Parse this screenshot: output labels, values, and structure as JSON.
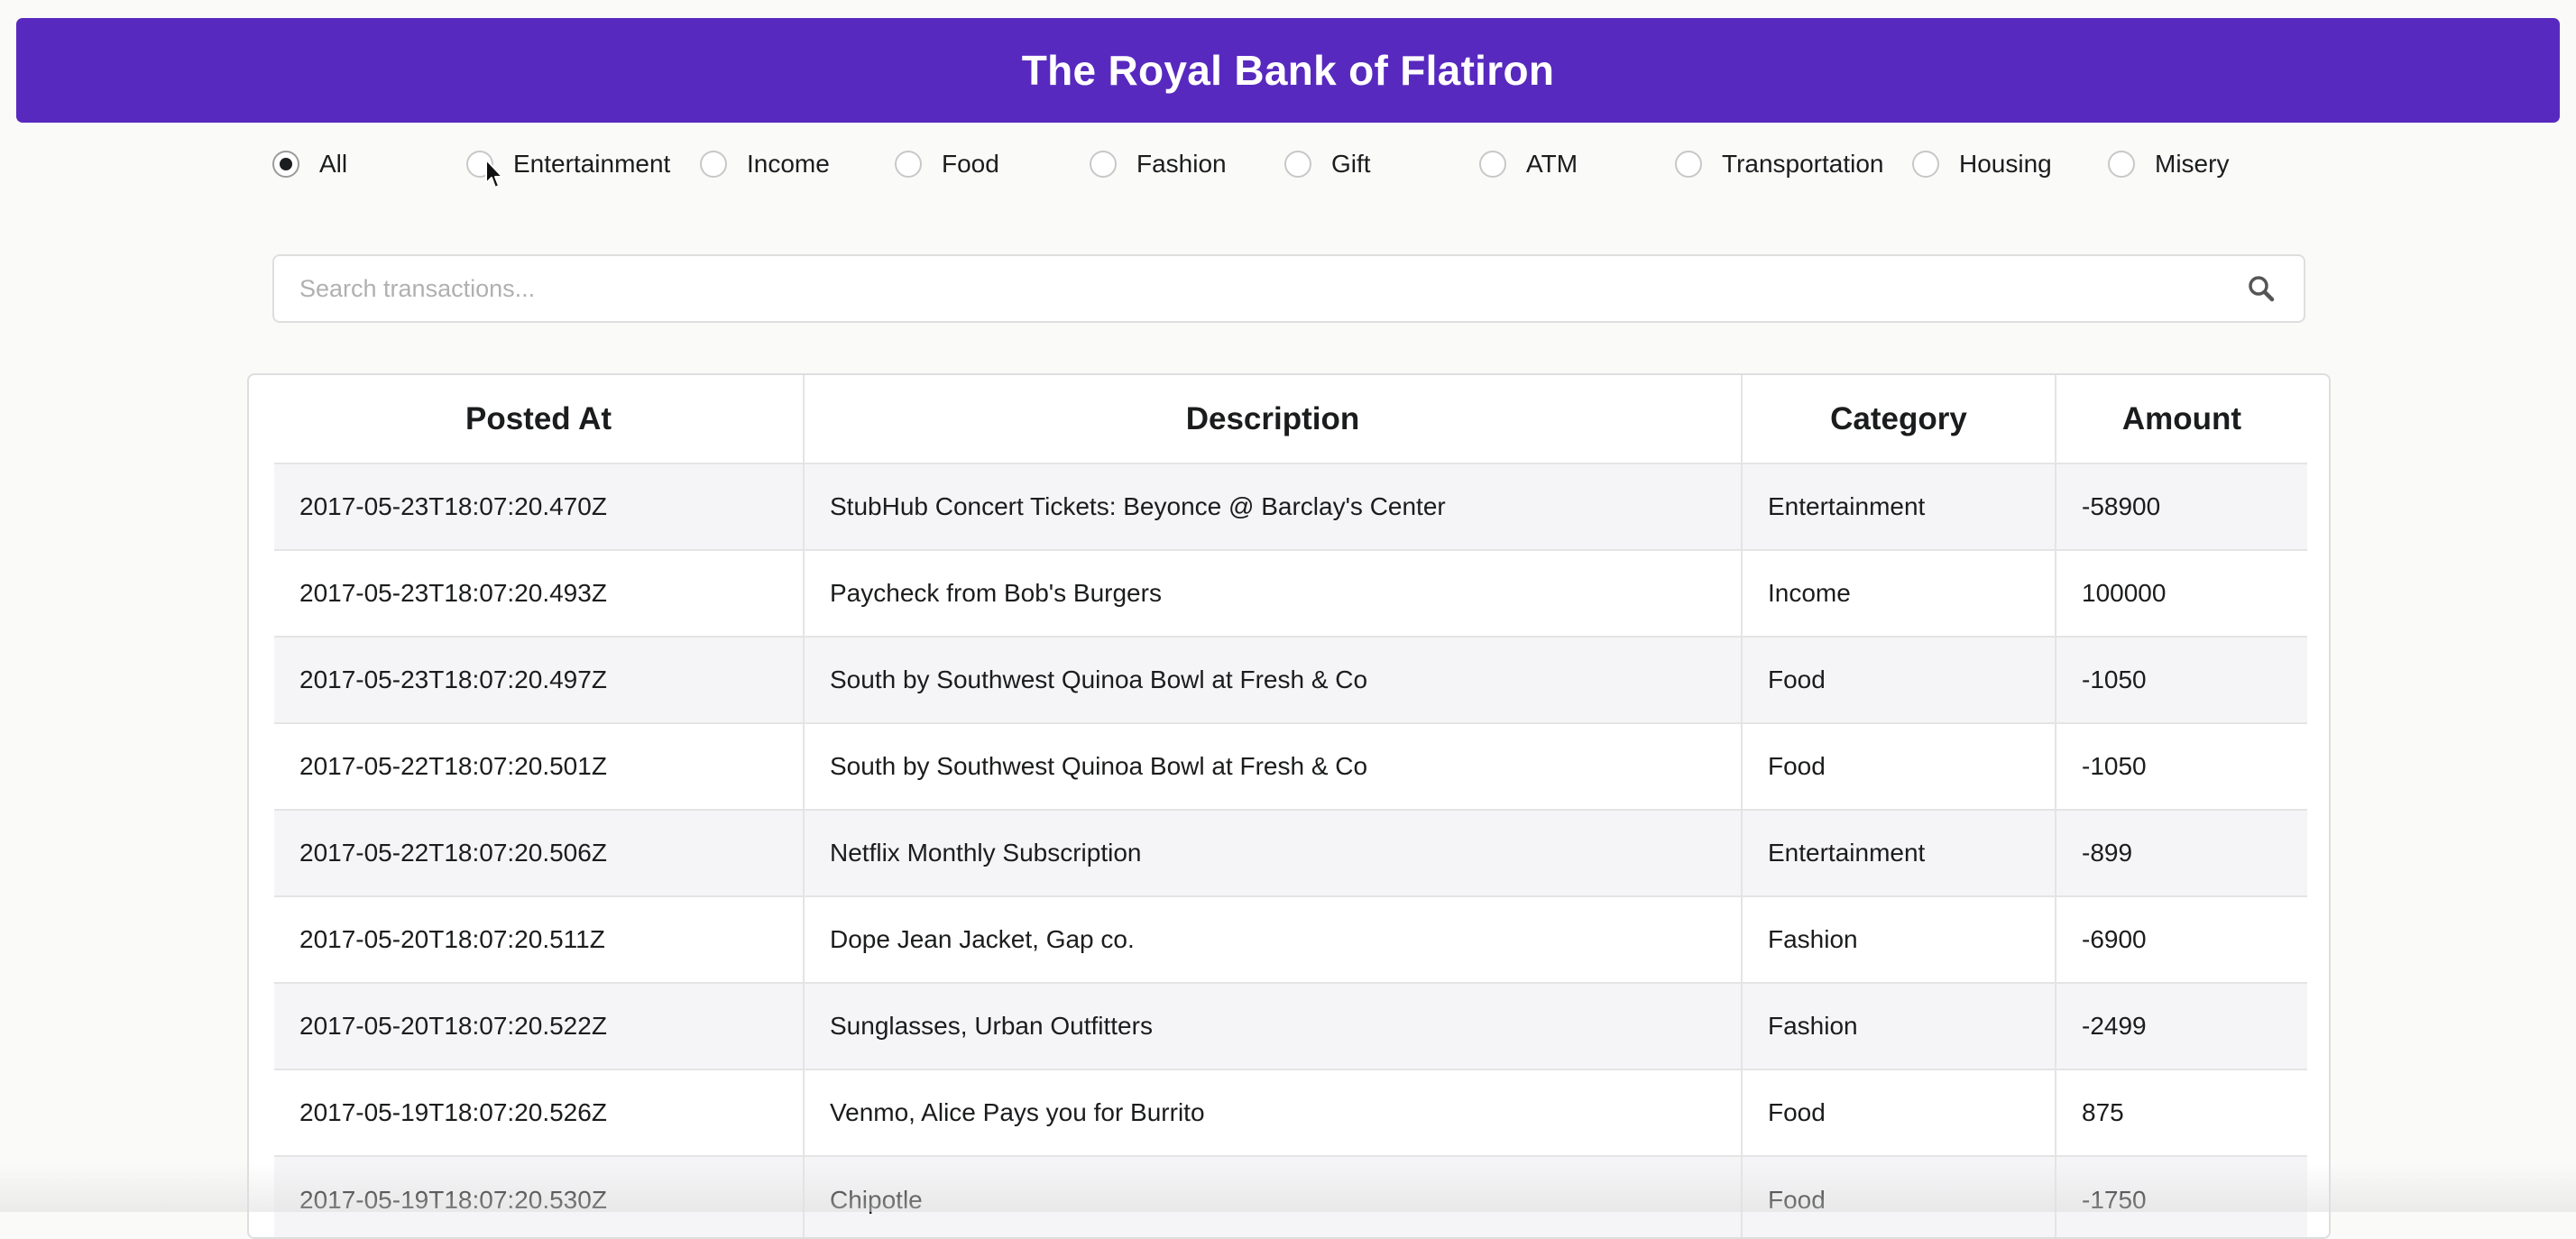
{
  "header": {
    "title": "The Royal Bank of Flatiron",
    "color": "#5829bf"
  },
  "filters": [
    {
      "label": "All",
      "checked": true
    },
    {
      "label": "Entertainment",
      "checked": false
    },
    {
      "label": "Income",
      "checked": false
    },
    {
      "label": "Food",
      "checked": false
    },
    {
      "label": "Fashion",
      "checked": false
    },
    {
      "label": "Gift",
      "checked": false
    },
    {
      "label": "ATM",
      "checked": false
    },
    {
      "label": "Transportation",
      "checked": false
    },
    {
      "label": "Housing",
      "checked": false
    },
    {
      "label": "Misery",
      "checked": false
    }
  ],
  "search": {
    "placeholder": "Search transactions...",
    "value": "",
    "icon": "search-icon"
  },
  "table": {
    "headers": [
      "Posted At",
      "Description",
      "Category",
      "Amount"
    ],
    "rows": [
      [
        "2017-05-23T18:07:20.470Z",
        "StubHub Concert Tickets: Beyonce @ Barclay's Center",
        "Entertainment",
        "-58900"
      ],
      [
        "2017-05-23T18:07:20.493Z",
        "Paycheck from Bob's Burgers",
        "Income",
        "100000"
      ],
      [
        "2017-05-23T18:07:20.497Z",
        "South by Southwest Quinoa Bowl at Fresh & Co",
        "Food",
        "-1050"
      ],
      [
        "2017-05-22T18:07:20.501Z",
        "South by Southwest Quinoa Bowl at Fresh & Co",
        "Food",
        "-1050"
      ],
      [
        "2017-05-22T18:07:20.506Z",
        "Netflix Monthly Subscription",
        "Entertainment",
        "-899"
      ],
      [
        "2017-05-20T18:07:20.511Z",
        "Dope Jean Jacket, Gap co.",
        "Fashion",
        "-6900"
      ],
      [
        "2017-05-20T18:07:20.522Z",
        "Sunglasses, Urban Outfitters",
        "Fashion",
        "-2499"
      ],
      [
        "2017-05-19T18:07:20.526Z",
        "Venmo, Alice Pays you for Burrito",
        "Food",
        "875"
      ],
      [
        "2017-05-19T18:07:20.530Z",
        "Chipotle",
        "Food",
        "-1750"
      ]
    ]
  }
}
